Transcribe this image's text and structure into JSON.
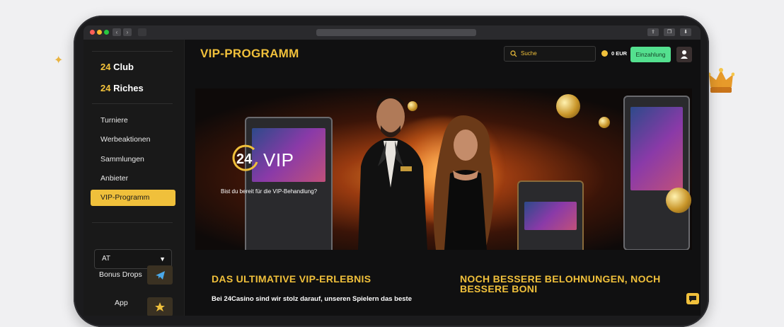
{
  "brand_menu": [
    {
      "num": "24",
      "label": "Club"
    },
    {
      "num": "24",
      "label": "Riches"
    }
  ],
  "nav": [
    "Turniere",
    "Werbeaktionen",
    "Sammlungen",
    "Anbieter",
    "VIP-Programm"
  ],
  "region": {
    "selected": "AT"
  },
  "sidebar_extras": {
    "bonus_drops": "Bonus Drops",
    "app": "App"
  },
  "header": {
    "title": "VIP-PROGRAMM",
    "search_placeholder": "Suche",
    "balance": "0 EUR",
    "deposit_label": "Einzahlung"
  },
  "hero": {
    "logo_number": "24",
    "logo_word": "VIP",
    "subtitle": "Bist du bereit für die VIP-Behandlung?"
  },
  "sections": [
    {
      "title": "DAS ULTIMATIVE VIP-ERLEBNIS",
      "text": "Bei 24Casino sind wir stolz darauf, unseren Spielern das beste"
    },
    {
      "title_line1": "NOCH BESSERE BELOHNUNGEN, NOCH",
      "title_line2": "BESSERE BONI"
    }
  ],
  "colors": {
    "accent": "#f0c03b",
    "deposit": "#54e08f",
    "background": "#101011"
  }
}
